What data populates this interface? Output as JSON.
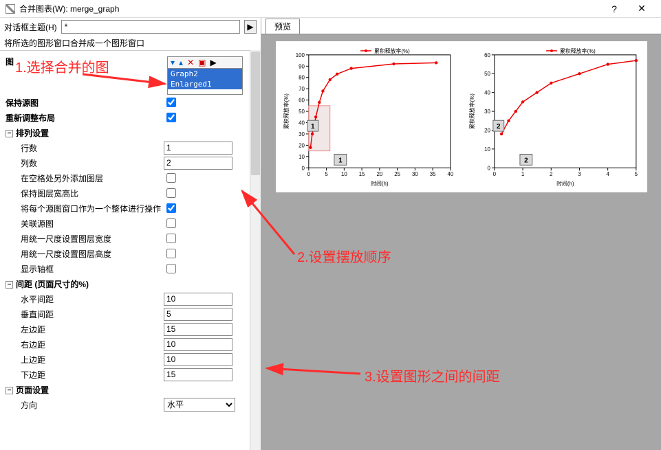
{
  "window": {
    "title": "合并图表(W): merge_graph",
    "help_icon": "?",
    "close_icon": "✕"
  },
  "dialog_theme": {
    "label": "对话框主题(H)",
    "value": "*"
  },
  "subtitle": "将所选的图形窗口合并成一个图形窗口",
  "graph_picker": {
    "items": [
      "Graph2",
      "Enlarged1"
    ]
  },
  "form": {
    "graph_label": "图",
    "keep_source": {
      "label": "保持源图",
      "checked": true
    },
    "rearrange": {
      "label": "重新调整布局",
      "checked": true
    },
    "arrange_section": "排列设置",
    "rows": {
      "label": "行数",
      "value": "1"
    },
    "cols": {
      "label": "列数",
      "value": "2"
    },
    "add_layer_empty": {
      "label": "在空格处另外添加图层",
      "checked": false
    },
    "keep_aspect": {
      "label": "保持图层宽高比",
      "checked": false
    },
    "treat_whole": {
      "label": "将每个源图窗口作为一个整体进行操作",
      "checked": true
    },
    "link_source": {
      "label": "关联源图",
      "checked": false
    },
    "uniform_w": {
      "label": "用统一尺度设置图层宽度",
      "checked": false
    },
    "uniform_h": {
      "label": "用统一尺度设置图层高度",
      "checked": false
    },
    "show_frame": {
      "label": "显示轴框",
      "checked": false
    },
    "spacing_section": "间距 (页面尺寸的%)",
    "h_gap": {
      "label": "水平间距",
      "value": "10"
    },
    "v_gap": {
      "label": "垂直间距",
      "value": "5"
    },
    "left_m": {
      "label": "左边距",
      "value": "15"
    },
    "right_m": {
      "label": "右边距",
      "value": "10"
    },
    "top_m": {
      "label": "上边距",
      "value": "10"
    },
    "bottom_m": {
      "label": "下边距",
      "value": "15"
    },
    "page_section": "页面设置",
    "orientation": {
      "label": "方向",
      "value": "水平"
    }
  },
  "preview": {
    "tab_label": "预览"
  },
  "annotations": {
    "a1": "1.选择合并的图",
    "a2": "2.设置摆放顺序",
    "a3": "3.设置图形之间的间距"
  },
  "chart_data": [
    {
      "type": "line",
      "legend": "累积释放率(%)",
      "xlabel": "时间(h)",
      "ylabel": "累积释放率(%)",
      "xlim": [
        0,
        40
      ],
      "ylim": [
        0,
        100
      ],
      "xticks": [
        0,
        5,
        10,
        15,
        20,
        25,
        30,
        35,
        40
      ],
      "yticks": [
        0,
        10,
        20,
        30,
        40,
        50,
        60,
        70,
        80,
        90,
        100
      ],
      "x": [
        0.5,
        1,
        2,
        3,
        4,
        6,
        8,
        12,
        24,
        36
      ],
      "y": [
        18,
        30,
        45,
        58,
        68,
        78,
        83,
        88,
        92,
        93
      ],
      "zoom_region": {
        "x0": 0,
        "x1": 6,
        "y0": 15,
        "y1": 55
      },
      "box_number": "1",
      "inset_number": "1"
    },
    {
      "type": "line",
      "legend": "累积释放率(%)",
      "xlabel": "时间(h)",
      "ylabel": "累积释放率(%)",
      "xlim": [
        0,
        5
      ],
      "ylim": [
        0,
        60
      ],
      "xticks": [
        0,
        1,
        2,
        3,
        4,
        5
      ],
      "yticks": [
        0,
        10,
        20,
        30,
        40,
        50,
        60
      ],
      "x": [
        0.25,
        0.5,
        0.75,
        1,
        1.5,
        2,
        3,
        4,
        5
      ],
      "y": [
        18,
        25,
        30,
        35,
        40,
        45,
        50,
        55,
        57
      ],
      "box_number": "2",
      "inset_number": "2"
    }
  ]
}
